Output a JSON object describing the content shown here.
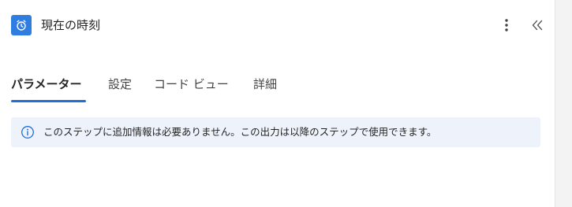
{
  "header": {
    "title": "現在の時刻",
    "app_icon": "alarm-clock-icon",
    "more_icon": "more-vertical-icon",
    "collapse_icon": "double-chevron-left-icon"
  },
  "tabs": [
    {
      "label": "パラメーター",
      "active": true
    },
    {
      "label": "設定",
      "active": false
    },
    {
      "label": "コード ビュー",
      "active": false
    },
    {
      "label": "詳細",
      "active": false
    }
  ],
  "info": {
    "icon": "info-icon",
    "text": "このステップに追加情報は必要ありません。この出力は以降のステップで使用できます。"
  },
  "colors": {
    "accent": "#1f6fd6",
    "app_icon_bg": "#2f7de1",
    "info_bg": "#eef3fb"
  }
}
